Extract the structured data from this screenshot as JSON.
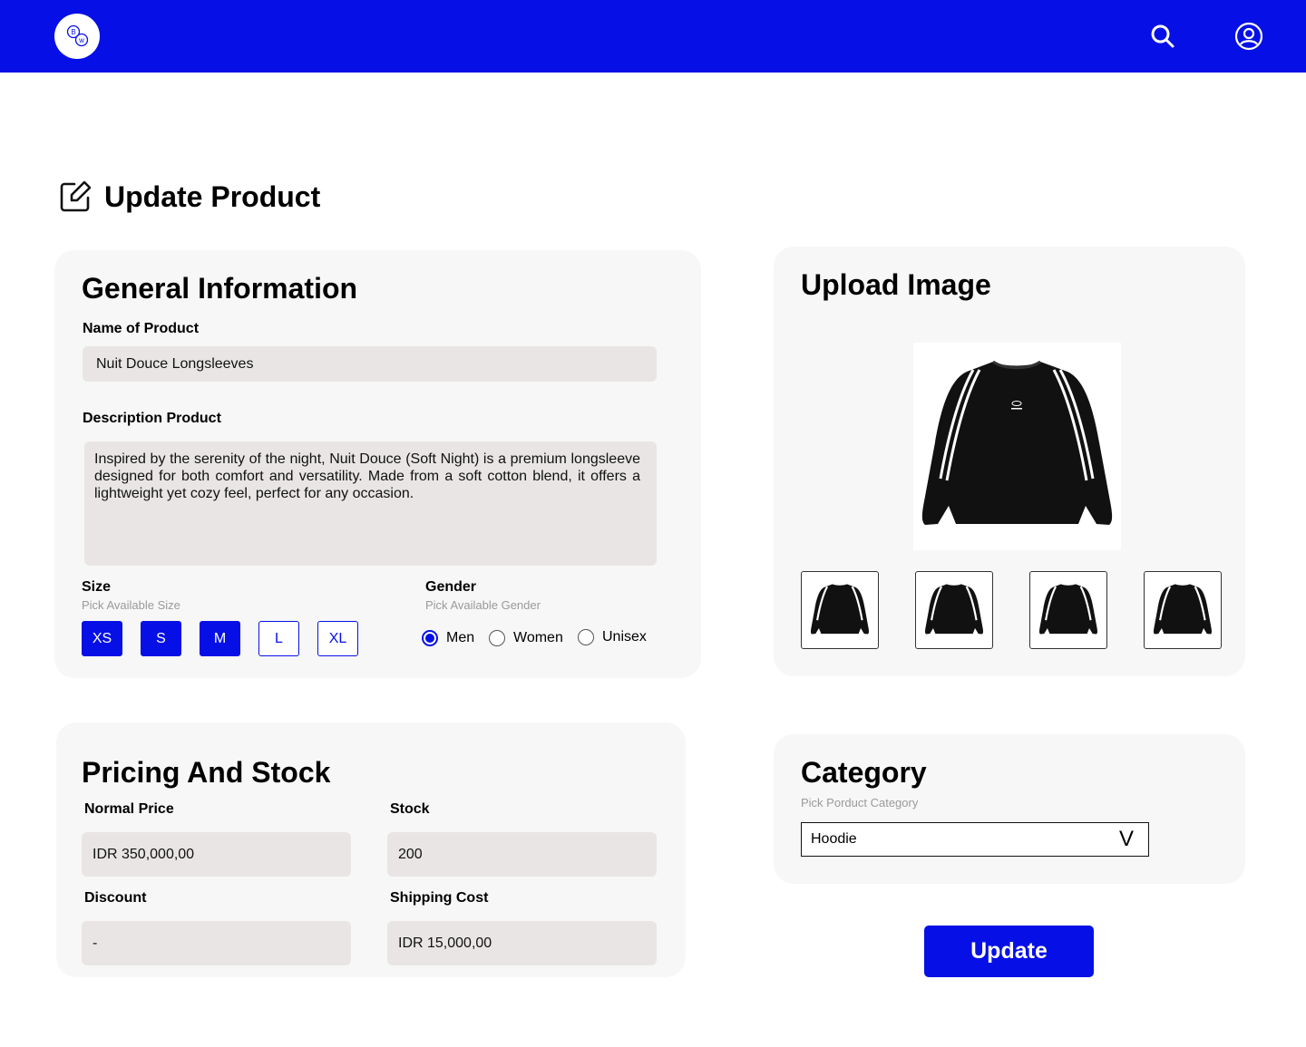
{
  "header": {
    "logo_text_top": "B",
    "logo_text_bottom": "w",
    "logo_icon": "brand-logo-icon",
    "search_icon": "search-icon",
    "profile_icon": "user-circle-icon",
    "brand_color": "#0610e6"
  },
  "page": {
    "title": "Update Product",
    "title_icon": "edit-square-icon"
  },
  "general": {
    "title": "General Information",
    "name_label": "Name of Product",
    "name_value": "Nuit Douce Longsleeves",
    "desc_label": "Description Product",
    "desc_value": "Inspired by the serenity of the night, Nuit Douce (Soft Night) is a premium longsleeve designed for both comfort and versatility. Made from a soft cotton blend, it offers a lightweight yet cozy feel, perfect for any occasion.",
    "size_label": "Size",
    "size_hint": "Pick Available Size",
    "sizes": [
      {
        "label": "XS",
        "selected": true
      },
      {
        "label": "S",
        "selected": true
      },
      {
        "label": "M",
        "selected": true
      },
      {
        "label": "L",
        "selected": false
      },
      {
        "label": "XL",
        "selected": false
      }
    ],
    "gender_label": "Gender",
    "gender_hint": "Pick Available Gender",
    "genders": [
      {
        "label": "Men",
        "selected": true
      },
      {
        "label": "Women",
        "selected": false
      },
      {
        "label": "Unisex",
        "selected": false
      }
    ]
  },
  "upload": {
    "title": "Upload Image",
    "main_image": "black-longsleeve-sweatshirt-image",
    "thumbnail_count": 4
  },
  "pricing": {
    "title": "Pricing And Stock",
    "normal_price_label": "Normal Price",
    "normal_price_value": "IDR 350,000,00",
    "stock_label": "Stock",
    "stock_value": "200",
    "discount_label": "Discount",
    "discount_value": "-",
    "shipping_label": "Shipping Cost",
    "shipping_value": "IDR 15,000,00"
  },
  "category": {
    "title": "Category",
    "hint": "Pick Porduct Category",
    "selected": "Hoodie",
    "chevron": "V"
  },
  "actions": {
    "update_label": "Update"
  }
}
